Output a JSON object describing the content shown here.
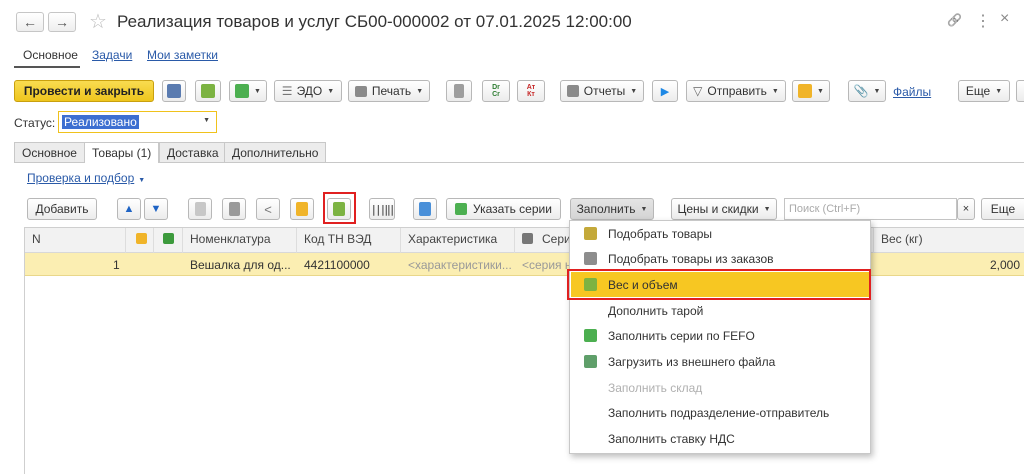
{
  "window": {
    "title": "Реализация товаров и услуг СБ00-000002 от 07.01.2025 12:00:00",
    "back_glyph": "←",
    "forward_glyph": "→",
    "star_glyph": "☆",
    "link_glyph": "🔗",
    "more_glyph": "⋮",
    "close_glyph": "×"
  },
  "top_tabs": [
    "Основное",
    "Задачи",
    "Мои заметки"
  ],
  "toolbar": {
    "post_close": "Провести и закрыть",
    "edo": "ЭДО",
    "print": "Печать",
    "dt_kt": "Dr Cr",
    "at_kt": "Ат Кт",
    "reports": "Отчеты",
    "send": "Отправить",
    "files": "Файлы",
    "more": "Еще"
  },
  "status": {
    "label": "Статус:",
    "value": "Реализовано"
  },
  "doc_tabs": [
    "Основное",
    "Товары (1)",
    "Доставка",
    "Дополнительно"
  ],
  "check_link": "Проверка и подбор",
  "table_toolbar": {
    "add": "Добавить",
    "series": "Указать серии",
    "fill": "Заполнить",
    "prices": "Цены и скидки",
    "search_placeholder": "Поиск (Ctrl+F)",
    "search_clear": "×",
    "more": "Еще"
  },
  "table": {
    "headers": [
      "N",
      "Номенклатура",
      "Код ТН ВЭД",
      "Характеристика",
      "Сери",
      "Вес (кг)"
    ],
    "rows": [
      {
        "n": "1",
        "nom": "Вешалка для од...",
        "code": "4421100000",
        "char": "<характеристики...",
        "series": "<серия н",
        "weight": "2,000"
      }
    ]
  },
  "fill_menu": {
    "items": [
      {
        "label": "Подобрать товары",
        "disabled": false
      },
      {
        "label": "Подобрать товары из заказов",
        "disabled": false
      },
      {
        "label": "Вес и объем",
        "disabled": false,
        "highlighted": true
      },
      {
        "label": "Дополнить тарой",
        "disabled": false
      },
      {
        "label": "Заполнить серии по FEFO",
        "disabled": false
      },
      {
        "label": "Загрузить из внешнего файла",
        "disabled": false
      },
      {
        "label": "Заполнить склад",
        "disabled": true
      },
      {
        "label": "Заполнить подразделение-отправитель",
        "disabled": false
      },
      {
        "label": "Заполнить ставку НДС",
        "disabled": false
      }
    ]
  },
  "colors": {
    "accent_yellow": "#f5d034",
    "highlight_red": "#e02020",
    "selected_row": "#fbeeb2",
    "link_blue": "#2a5aa8"
  }
}
